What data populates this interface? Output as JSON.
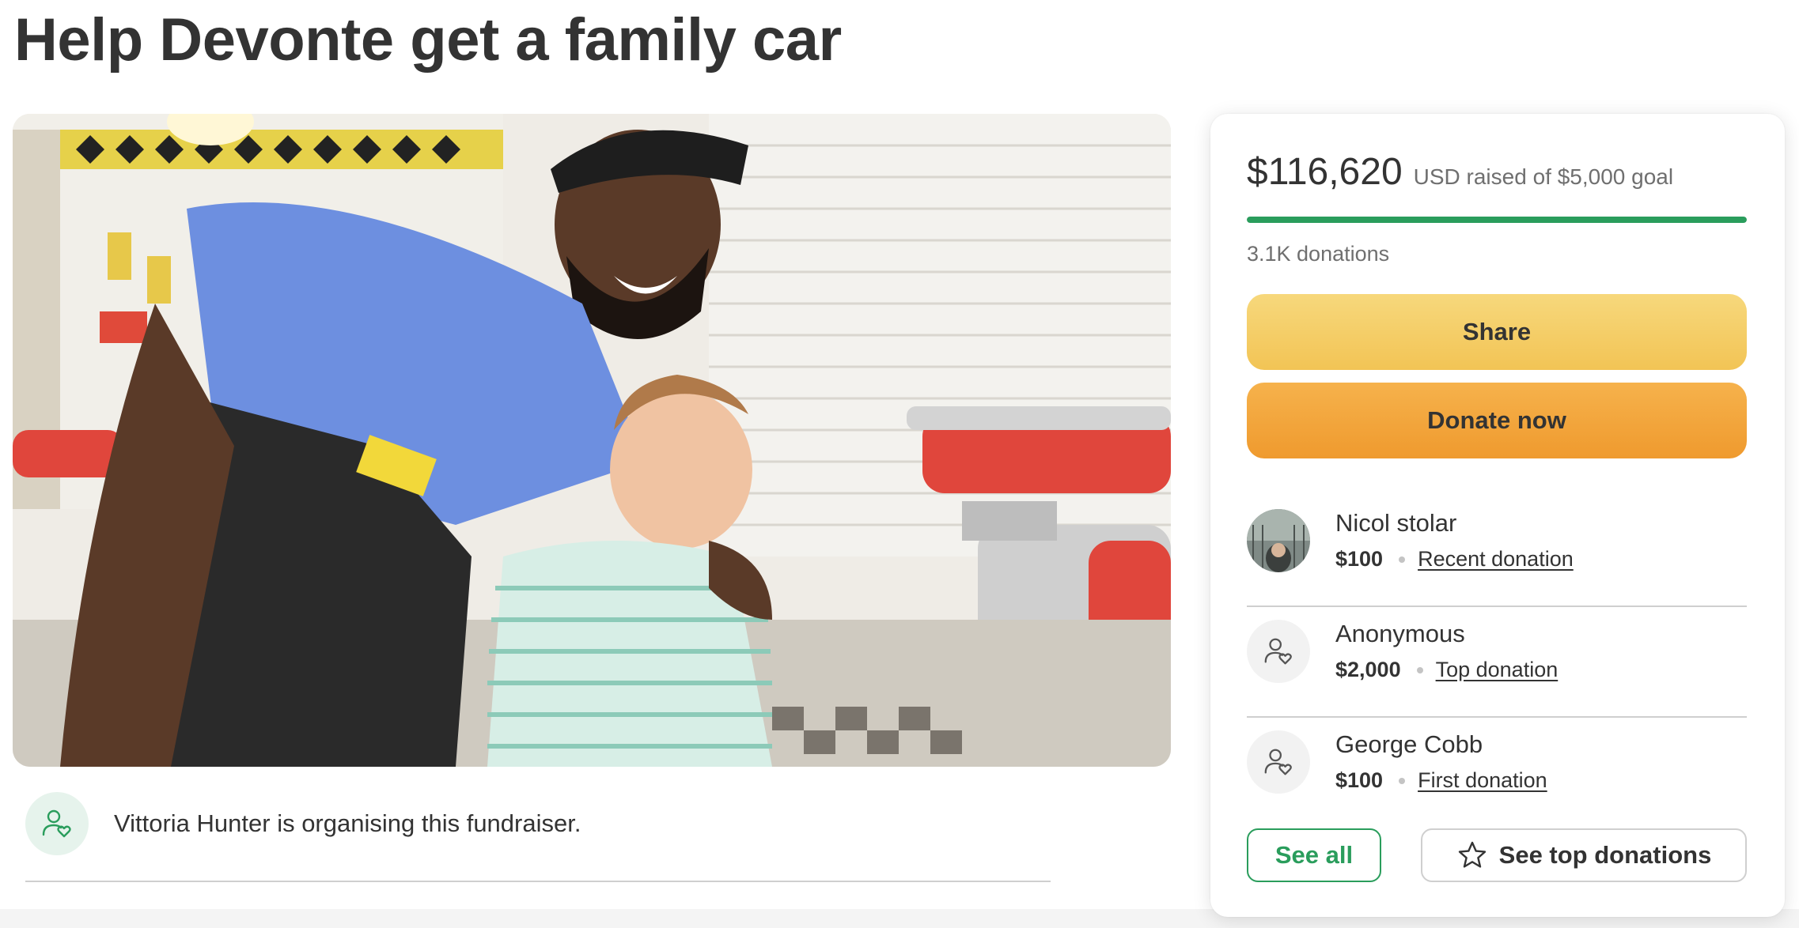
{
  "page": {
    "title": "Help Devonte get a family car"
  },
  "organiser": {
    "text": "Vittoria Hunter is organising this fundraiser.",
    "icon": "user-heart-icon"
  },
  "donation_card": {
    "raised_amount": "$116,620",
    "raised_sub": "USD raised of $5,000 goal",
    "progress_fraction": 1.0,
    "donation_count": "3.1K donations",
    "share_label": "Share",
    "donate_label": "Donate now",
    "donors": [
      {
        "name": "Nicol stolar",
        "amount": "$100",
        "tag": "Recent donation",
        "avatar": "photo"
      },
      {
        "name": "Anonymous",
        "amount": "$2,000",
        "tag": "Top donation",
        "avatar": "user-heart-icon"
      },
      {
        "name": "George Cobb",
        "amount": "$100",
        "tag": "First donation",
        "avatar": "user-heart-icon"
      }
    ],
    "see_all_label": "See all",
    "see_top_label": "See top donations"
  },
  "colors": {
    "accent_green": "#2a9d5c",
    "share_yellow": "#f2c455",
    "donate_orange": "#ef9a2e"
  }
}
